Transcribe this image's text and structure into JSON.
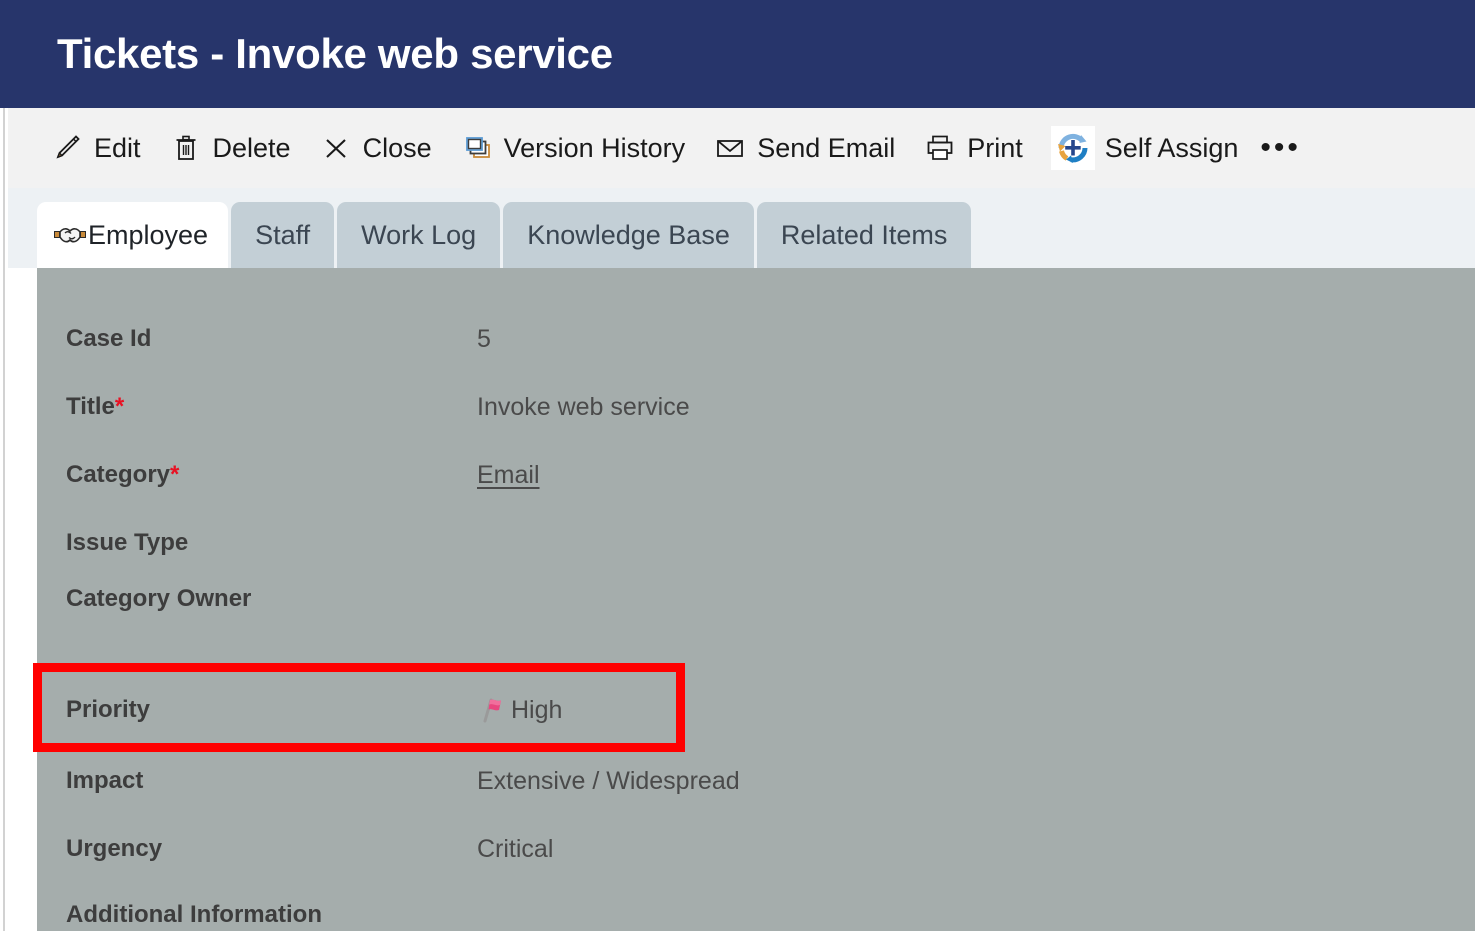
{
  "header": {
    "title": "Tickets - Invoke web service",
    "bg_color": "#27356b",
    "text_color": "#ffffff"
  },
  "toolbar": {
    "items": [
      {
        "label": "Edit",
        "icon": "pencil-icon"
      },
      {
        "label": "Delete",
        "icon": "trash-icon"
      },
      {
        "label": "Close",
        "icon": "close-x-icon"
      },
      {
        "label": "Version History",
        "icon": "version-history-icon"
      },
      {
        "label": "Send Email",
        "icon": "envelope-icon"
      },
      {
        "label": "Print",
        "icon": "printer-icon"
      },
      {
        "label": "Self Assign",
        "icon": "self-assign-icon"
      }
    ],
    "overflow_label": "•••"
  },
  "tabs": [
    {
      "label": "Employee",
      "active": true,
      "icon": "handshake-icon"
    },
    {
      "label": "Staff",
      "active": false
    },
    {
      "label": "Work Log",
      "active": false
    },
    {
      "label": "Knowledge Base",
      "active": false
    },
    {
      "label": "Related Items",
      "active": false
    }
  ],
  "form": {
    "background_color": "#a5adac",
    "fields": [
      {
        "label": "Case Id",
        "required": false,
        "value": "5",
        "type": "text"
      },
      {
        "label": "Title",
        "required": true,
        "value": "Invoke web service",
        "type": "text"
      },
      {
        "label": "Category",
        "required": true,
        "value": "Email",
        "type": "link"
      },
      {
        "label": "Issue Type",
        "required": false,
        "value": "",
        "type": "text"
      },
      {
        "label": "Category Owner",
        "required": false,
        "value": "",
        "type": "text"
      },
      {
        "label": "Priority",
        "required": false,
        "value": "High",
        "type": "flag",
        "icon": "pink-flag-icon",
        "highlighted": true
      },
      {
        "label": "Impact",
        "required": false,
        "value": "Extensive / Widespread",
        "type": "text"
      },
      {
        "label": "Urgency",
        "required": false,
        "value": "Critical",
        "type": "text"
      },
      {
        "label": "Additional Information",
        "required": false,
        "value": "",
        "type": "text"
      }
    ]
  },
  "annotation": {
    "color": "#ff0000",
    "target_field": "Priority"
  }
}
